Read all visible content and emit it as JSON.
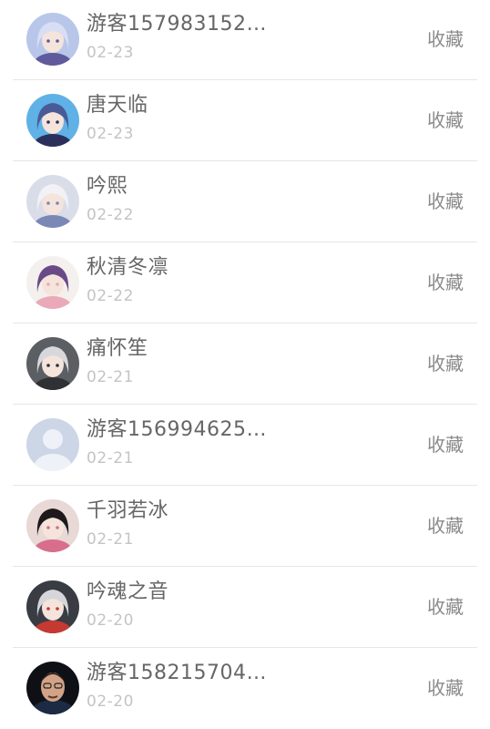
{
  "records": [
    {
      "name": "游客157983152…",
      "date": "02-23",
      "action": "收藏",
      "avatar": {
        "kind": "anime-girl-blue",
        "bg": "#b8c6ea",
        "hair": "#d8def4",
        "accent": "#5e5a9c"
      }
    },
    {
      "name": "唐天临",
      "date": "02-23",
      "action": "收藏",
      "avatar": {
        "kind": "anime-dark-blue",
        "bg": "#5fb1e6",
        "hair": "#4a5a96",
        "accent": "#2b2f5c"
      }
    },
    {
      "name": "吟熙",
      "date": "02-22",
      "action": "收藏",
      "avatar": {
        "kind": "anime-white",
        "bg": "#d9dde8",
        "hair": "#f2f2f6",
        "accent": "#7b88b6"
      }
    },
    {
      "name": "秋清冬凛",
      "date": "02-22",
      "action": "收藏",
      "avatar": {
        "kind": "anime-purple-bunny",
        "bg": "#f4f0ee",
        "hair": "#6a4a86",
        "accent": "#e9a9b8"
      }
    },
    {
      "name": "痛怀笙",
      "date": "02-21",
      "action": "收藏",
      "avatar": {
        "kind": "anime-gray",
        "bg": "#5b5e63",
        "hair": "#d8d8dc",
        "accent": "#2f3135"
      }
    },
    {
      "name": "游客156994625…",
      "date": "02-21",
      "action": "收藏",
      "avatar": {
        "kind": "default-placeholder",
        "bg": "#cdd6e6",
        "hair": "#eef1f7",
        "accent": "#eef1f7"
      }
    },
    {
      "name": "千羽若冰",
      "date": "02-21",
      "action": "收藏",
      "avatar": {
        "kind": "anime-black-pink",
        "bg": "#e8d8d6",
        "hair": "#1e1a1c",
        "accent": "#d86e8c"
      }
    },
    {
      "name": "吟魂之音",
      "date": "02-20",
      "action": "收藏",
      "avatar": {
        "kind": "anime-dark-red",
        "bg": "#3a3c44",
        "hair": "#d6d6da",
        "accent": "#c43a32"
      }
    },
    {
      "name": "游客158215704…",
      "date": "02-20",
      "action": "收藏",
      "avatar": {
        "kind": "man-suit",
        "bg": "#0f1016",
        "hair": "#2a1e18",
        "accent": "#d2a386"
      }
    }
  ]
}
